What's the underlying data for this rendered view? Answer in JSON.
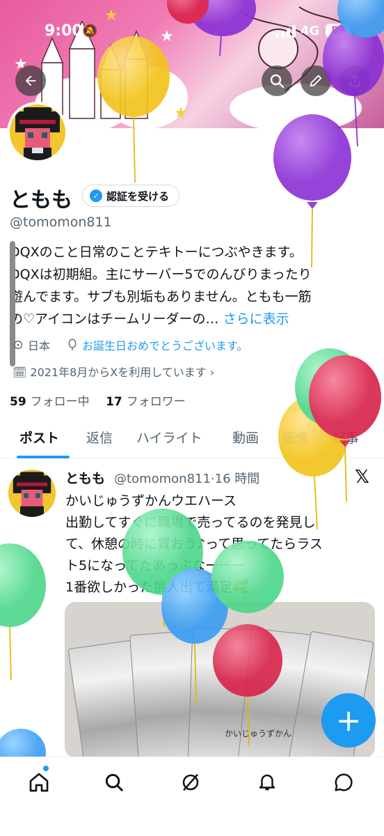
{
  "status_bar": {
    "time": "9:00",
    "network": "4G",
    "battery": "89"
  },
  "header": {
    "back_icon": "arrow-left-icon",
    "search_icon": "search-icon",
    "edit_icon": "pencil-icon",
    "share_icon": "share-icon"
  },
  "profile": {
    "display_name": "ともも",
    "verify_label": "認証を受ける",
    "handle": "@tomomon811",
    "bio_lines": [
      "DQXのこと日常のことテキトーにつぶやきます。",
      "DQXは初期組。主にサーバー5でのんびりまったり",
      "遊んでます。サブも別垢もありません。ともも一筋",
      "の♡アイコンはチームリーダーの… "
    ],
    "bio_more": "さらに表示",
    "location": "日本",
    "birthday": "お誕生日おめでとうございます。",
    "joined": "2021年8月からXを利用しています",
    "following_count": "59",
    "following_label": "フォロー中",
    "followers_count": "17",
    "followers_label": "フォロワー"
  },
  "tabs": [
    "ポスト",
    "返信",
    "ハイライト",
    "動画",
    "画像",
    "記事"
  ],
  "post": {
    "name": "ともも",
    "handle_time": "@tomomon811·16 時間",
    "text": "かいじゅうずかんウエハース\n出勤してすぐに職場で売ってるのを発見し\nて、休憩の時に買おう♪って思ってたらラス\nト5になってたあっぶなーーー\n1番欲しかった狼人出て満足🥰",
    "pack_label": "かいじゅうずかん"
  },
  "colors": {
    "accent": "#1d9bf0",
    "text": "#0f1419",
    "secondary": "#536471"
  },
  "bottom_nav": [
    "home-icon",
    "search-icon",
    "grok-icon",
    "notifications-icon",
    "messages-icon"
  ]
}
